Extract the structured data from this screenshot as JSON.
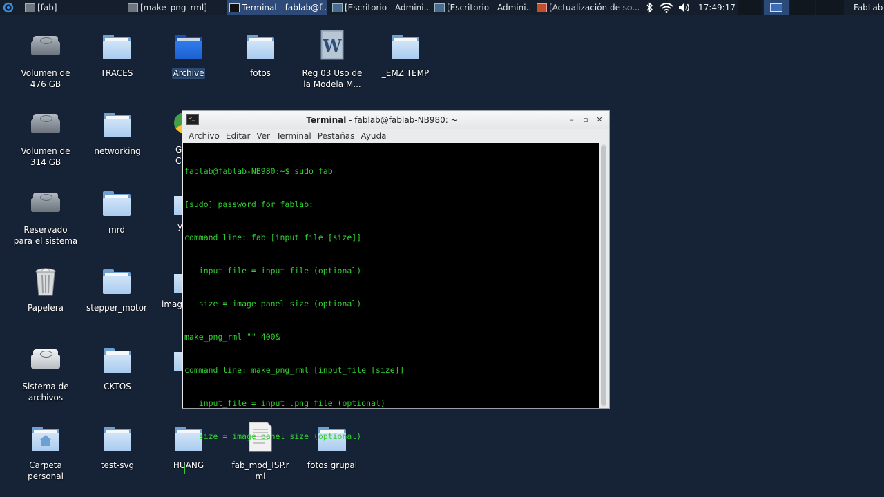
{
  "panel": {
    "tasks": [
      {
        "label": "[fab]"
      },
      {
        "label": "[make_png_rml]"
      },
      {
        "label": "Terminal - fablab@f..."
      },
      {
        "label": "[Escritorio - Admini..."
      },
      {
        "label": "[Escritorio - Admini..."
      },
      {
        "label": "[Actualización de so..."
      }
    ],
    "clock": "17:49:17",
    "user": "FabLab",
    "colors": {
      "panel_bg": "#141e2c",
      "active_task": "#2d4a78"
    }
  },
  "desktop": {
    "background": "#162336",
    "icons": [
      {
        "label": "Volumen de\n476 GB",
        "type": "drive-icon"
      },
      {
        "label": "TRACES",
        "type": "folder-icon"
      },
      {
        "label": "Archive",
        "type": "folder-icon",
        "selected": true
      },
      {
        "label": "fotos",
        "type": "folder-icon"
      },
      {
        "label": "Reg 03 Uso de\nla Modela M...",
        "type": "word-document-icon"
      },
      {
        "label": "_EMZ TEMP",
        "type": "folder-icon"
      },
      {
        "label": "Volumen de\n314 GB",
        "type": "drive-icon"
      },
      {
        "label": "networking",
        "type": "folder-icon"
      },
      {
        "label": "Reservado\npara el sistema",
        "type": "drive-icon"
      },
      {
        "label": "mrd",
        "type": "folder-icon"
      },
      {
        "label": "Papelera",
        "type": "trash-icon"
      },
      {
        "label": "stepper_motor",
        "type": "folder-icon"
      },
      {
        "label": "Sistema de\narchivos",
        "type": "drive-icon"
      },
      {
        "label": "CKTOS",
        "type": "folder-icon"
      },
      {
        "label": "Carpeta\npersonal",
        "type": "home-folder-icon"
      },
      {
        "label": "test-svg",
        "type": "folder-icon"
      },
      {
        "label": "HUANG",
        "type": "folder-icon"
      },
      {
        "label": "fab_mod_ISP.r\nml",
        "type": "text-file-icon"
      },
      {
        "label": "fotos grupal",
        "type": "folder-icon"
      }
    ],
    "partial_labels": [
      "G",
      "Cl",
      "y",
      "imag"
    ]
  },
  "terminal": {
    "title_bold": "Terminal",
    "title_rest": " - fablab@fablab-NB980: ~",
    "menu": [
      "Archivo",
      "Editar",
      "Ver",
      "Terminal",
      "Pestañas",
      "Ayuda"
    ],
    "lines": [
      "fablab@fablab-NB980:~$ sudo fab",
      "[sudo] password for fablab:",
      "command line: fab [input_file [size]]",
      "   input_file = input file (optional)",
      "   size = image panel size (optional)",
      "make_png_rml \"\" 400&",
      "command line: make_png_rml [input_file [size]]",
      "   input_file = input .png file (optional)",
      "   size = image panel size (optional)"
    ],
    "text_color": "#2fd12f"
  }
}
